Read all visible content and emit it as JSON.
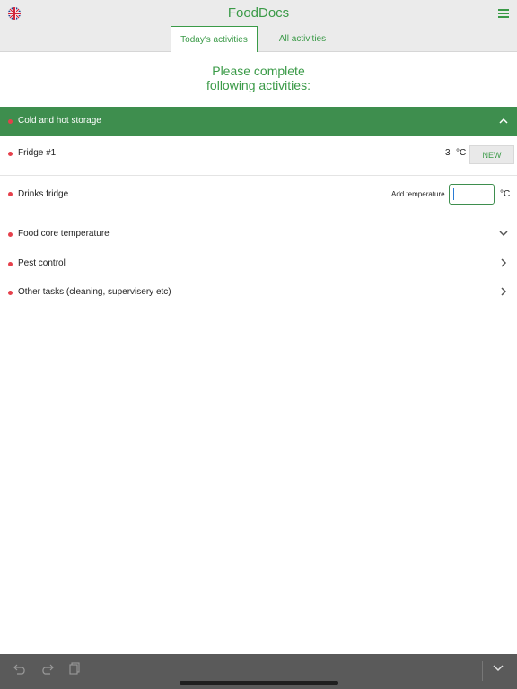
{
  "header": {
    "app_title": "FoodDocs",
    "language_icon": "uk-flag-icon",
    "menu_icon": "hamburger-menu-icon"
  },
  "tabs": [
    {
      "label": "Today's activities",
      "active": true
    },
    {
      "label": "All activities",
      "active": false
    }
  ],
  "main": {
    "heading_line1": "Please complete",
    "heading_line2": "following activities:"
  },
  "storage_section": {
    "title": "Cold and hot storage",
    "expanded": true,
    "items": [
      {
        "label": "Fridge #1",
        "value": "3",
        "unit": "°C",
        "button_label": "NEW"
      },
      {
        "label": "Drinks fridge",
        "add_label": "Add temperature",
        "input_value": "",
        "unit": "°C"
      }
    ]
  },
  "activities": [
    {
      "label": "Food core temperature",
      "icon": "chevron-down-icon"
    },
    {
      "label": "Pest control",
      "icon": "chevron-right-icon"
    },
    {
      "label": "Other tasks (cleaning, supervisery etc)",
      "icon": "chevron-right-icon"
    }
  ],
  "keyboard_bar": {
    "icons": [
      "undo-icon",
      "redo-icon",
      "paste-icon",
      "keyboard-dismiss-icon"
    ]
  },
  "colors": {
    "brand_green": "#3a9a47",
    "section_green": "#3e8e4e",
    "status_red": "#e5404b"
  }
}
